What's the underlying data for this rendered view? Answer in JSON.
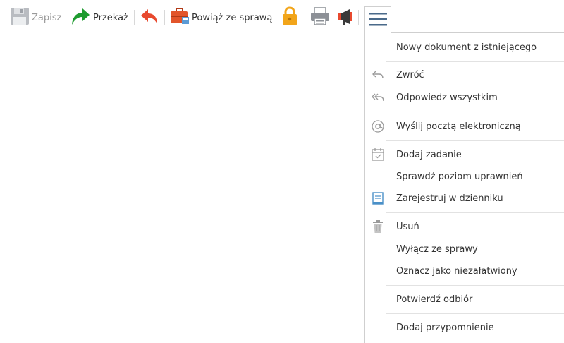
{
  "toolbar": {
    "save_label": "Zapisz",
    "forward_label": "Przekaż",
    "link_case_label": "Powiąż ze sprawą"
  },
  "menu": {
    "items": [
      {
        "label": "Nowy dokument z istniejącego",
        "icon": ""
      },
      {
        "label": "Zwróć",
        "icon": "return-icon"
      },
      {
        "label": "Odpowiedz wszystkim",
        "icon": "reply-all-icon"
      },
      {
        "label": "Wyślij pocztą elektroniczną",
        "icon": "at-sign-icon"
      },
      {
        "label": "Dodaj zadanie",
        "icon": "calendar-task-icon"
      },
      {
        "label": "Sprawdź poziom uprawnień",
        "icon": ""
      },
      {
        "label": "Zarejestruj w dzienniku",
        "icon": "journal-icon"
      },
      {
        "label": "Usuń",
        "icon": "trash-icon"
      },
      {
        "label": "Wyłącz ze sprawy",
        "icon": ""
      },
      {
        "label": "Oznacz jako niezałatwiony",
        "icon": ""
      },
      {
        "label": "Potwierdź odbiór",
        "icon": ""
      },
      {
        "label": "Dodaj przypomnienie",
        "icon": ""
      }
    ]
  },
  "colors": {
    "forward_arrow": "#1e9b2f",
    "undo_arrow": "#e8492e",
    "lock": "#f2a51a",
    "briefcase": "#e2552b",
    "hamburger": "#4a6a8a"
  }
}
